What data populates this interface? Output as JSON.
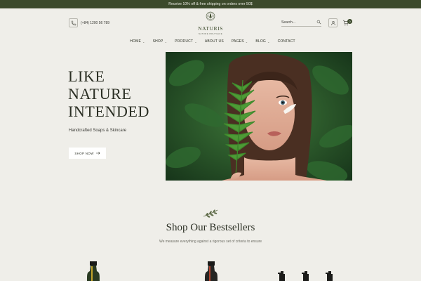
{
  "topbar": {
    "text": "Receive 10% off & free shipping on orders over 50$"
  },
  "header": {
    "phone": "(+84) 1200 56 789",
    "logo_name": "NATURIS",
    "logo_tagline": "NATURE BOUTIQUE",
    "search_placeholder": "Search...",
    "cart_count": "0"
  },
  "nav": {
    "items": [
      {
        "label": "HOME",
        "dropdown": true
      },
      {
        "label": "SHOP",
        "dropdown": true
      },
      {
        "label": "PRODUCT",
        "dropdown": true
      },
      {
        "label": "ABOUT US",
        "dropdown": false
      },
      {
        "label": "PAGES",
        "dropdown": true
      },
      {
        "label": "BLOG",
        "dropdown": true
      },
      {
        "label": "CONTACT",
        "dropdown": false
      }
    ]
  },
  "hero": {
    "title_lines": [
      "LIKE",
      "NATURE",
      "INTENDED"
    ],
    "subtitle": "Handcrafted  Soaps & Skincare",
    "button_label": "SHOP NOW"
  },
  "bestsellers": {
    "title": "Shop Our Bestsellers",
    "subtitle": "We measure everything against a rigorous set of criteria to ensure"
  },
  "colors": {
    "accent": "#3c4a2c",
    "background": "#efeee9",
    "button_bg": "#ffffff"
  },
  "icons": [
    "phone-icon",
    "search-icon",
    "user-icon",
    "cart-icon",
    "arrow-right-icon",
    "leaf-sprig-icon"
  ]
}
